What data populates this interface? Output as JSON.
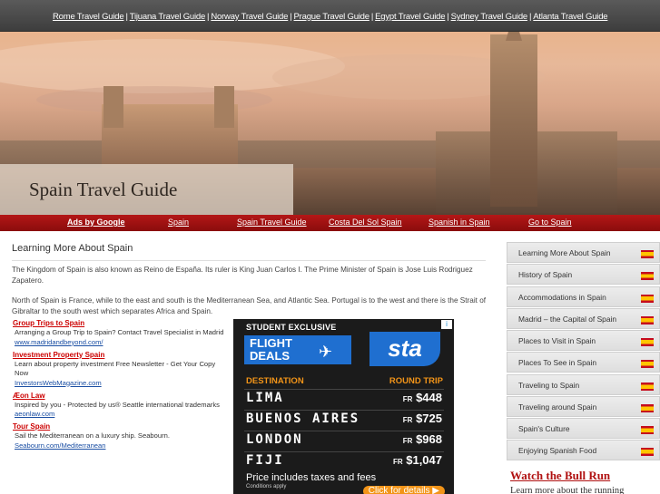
{
  "top_links": [
    "Rome Travel Guide",
    "Tijuana Travel Guide",
    "Norway Travel Guide",
    "Prague Travel Guide",
    "Egypt Travel Guide",
    "Sydney Travel Guide",
    "Atlanta Travel Guide"
  ],
  "top_separator": "|",
  "site_title": "Spain Travel Guide",
  "ad_bar": {
    "ads_by": "Ads by Google",
    "links": [
      "Spain",
      "Spain Travel Guide",
      "Costa Del Sol Spain",
      "Spanish in Spain",
      "Go to Spain"
    ]
  },
  "main": {
    "title": "Learning More About Spain",
    "para1": "The Kingdom of Spain is also known as Reino de España. Its ruler is King Juan Carlos I. The Prime Minister of Spain is Jose Luis Rodriguez Zapatero.",
    "para2": "North of Spain is France, while to the east and south is the Mediterranean Sea, and Atlantic Sea. Portugal is to the west and there is the Strait of Gibraltar to the south west which separates Africa and Spain."
  },
  "ads": [
    {
      "title": "Group Trips to Spain",
      "desc": "Arranging a Group Trip to Spain? Contact Travel Specialist in Madrid",
      "url": "www.madridandbeyond.com/"
    },
    {
      "title": "Investment Property Spain",
      "desc": "Learn about property investment Free Newsletter - Get Your Copy Now",
      "url": "InvestorsWebMagazine.com"
    },
    {
      "title": "Æon Law",
      "desc": "Inspired by you - Protected by us® Seattle international trademarks",
      "url": "aeonlaw.com"
    },
    {
      "title": "Tour Spain",
      "desc": "Sail the Mediterranean on a luxury ship. Seabourn.",
      "url": "Seabourn.com/Mediterranean"
    }
  ],
  "banner": {
    "adchoice": "i",
    "student": "STUDENT EXCLUSIVE",
    "flight": "FLIGHT",
    "deals": "DEALS",
    "brand": "sta",
    "dest_header": "DESTINATION",
    "trip_header": "ROUND TRIP",
    "routes": [
      {
        "city": "LIMA",
        "cur": "FR",
        "price": "$448"
      },
      {
        "city": "BUENOS AIRES",
        "cur": "FR",
        "price": "$725"
      },
      {
        "city": "LONDON",
        "cur": "FR",
        "price": "$968"
      },
      {
        "city": "FIJI",
        "cur": "FR",
        "price": "$1,047"
      }
    ],
    "taxes": "Price includes taxes and fees",
    "conditions": "Conditions apply",
    "cta": "Click for details ▶"
  },
  "sidebar": {
    "items": [
      "Learning More About Spain",
      "History of Spain",
      "Accommodations in Spain",
      "Madrid – the Capital of Spain",
      "Places to Visit in Spain",
      "Places To See in Spain",
      "Traveling to Spain",
      "Traveling around Spain",
      "Spain's Culture",
      "Enjoying Spanish Food"
    ],
    "promo_title": "Watch the Bull Run",
    "promo_text": "Learn more about the running"
  },
  "colors": {
    "accent_red": "#b41717",
    "link_red": "#cc0000",
    "link_blue": "#1a4ea3",
    "banner_blue": "#1f6fd0",
    "banner_orange": "#f29418"
  }
}
